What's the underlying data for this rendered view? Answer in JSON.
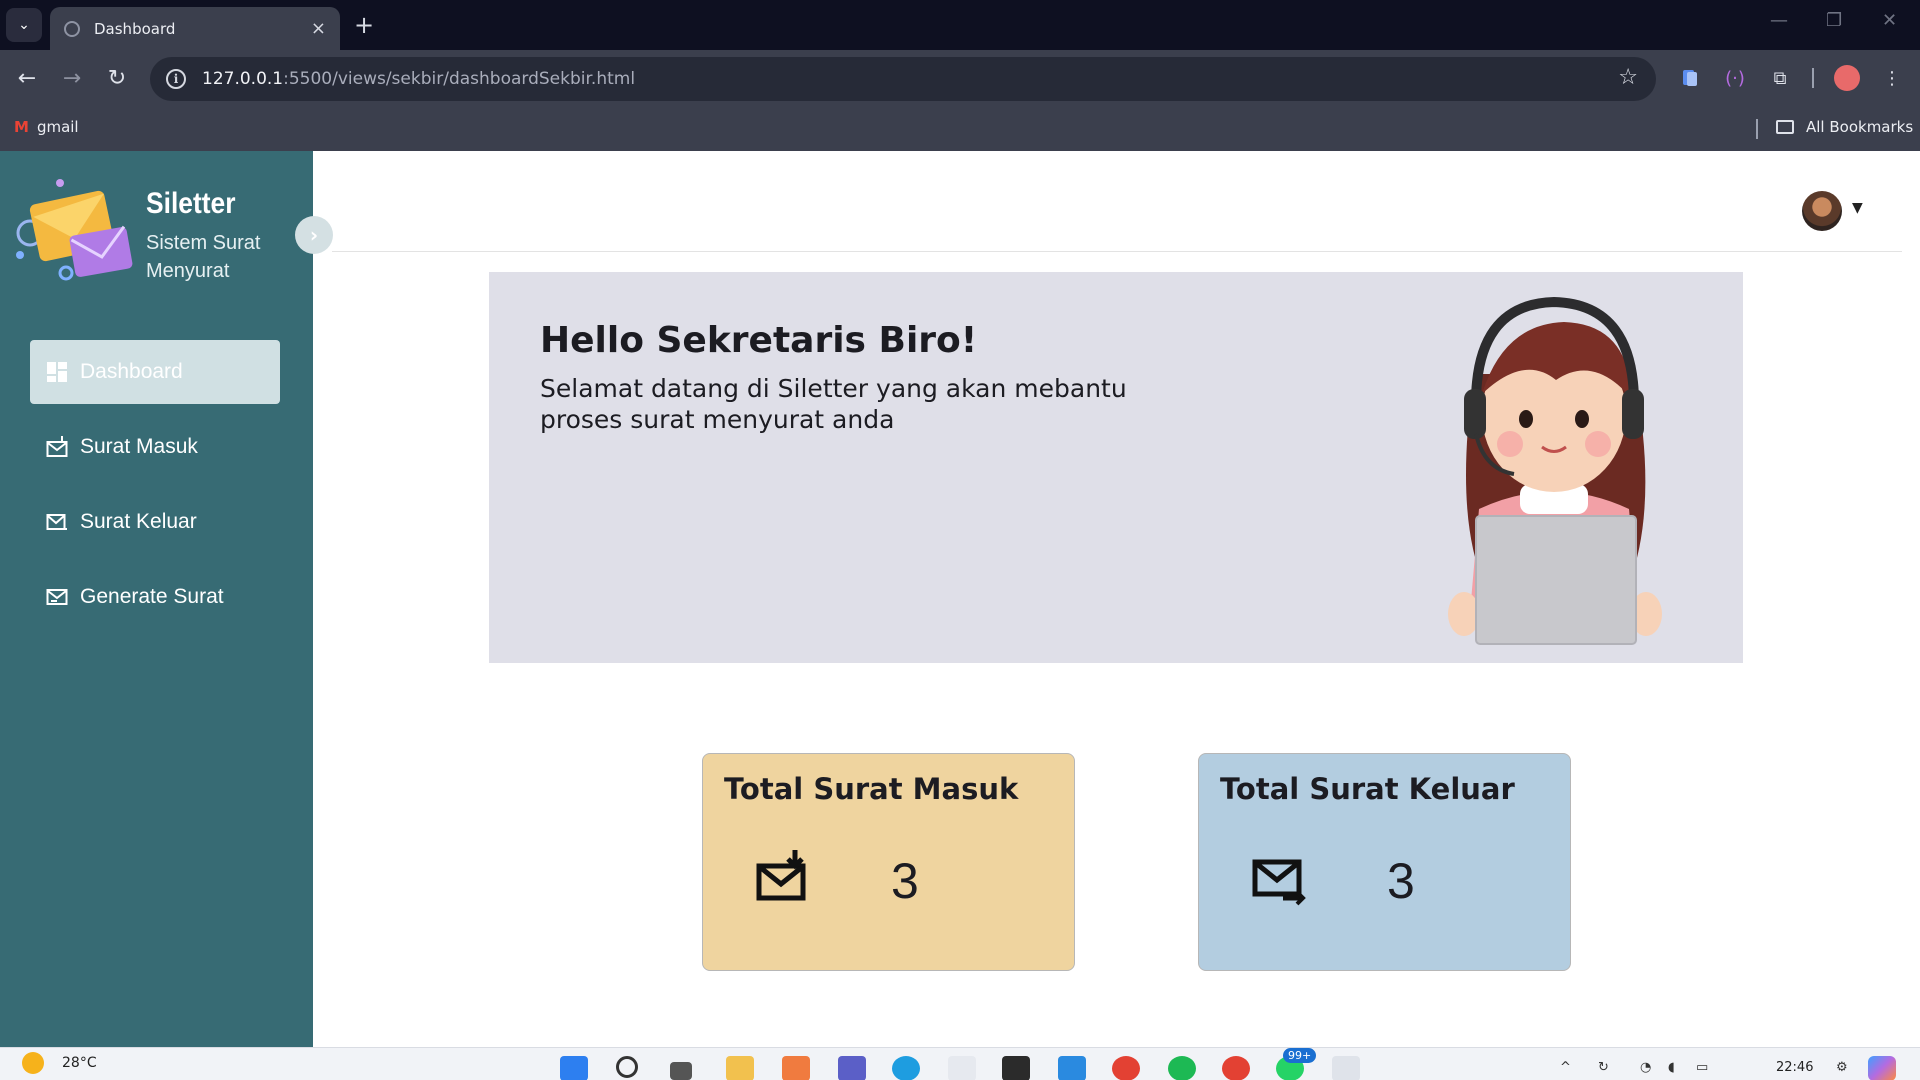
{
  "browser": {
    "tab_title": "Dashboard",
    "tab_close": "×",
    "new_tab": "+",
    "url_host": "127.0.0.1",
    "url_path": ":5500/views/sekbir/dashboardSekbir.html",
    "bookmarks": [
      {
        "label": "gmail",
        "icon": "gmail-icon"
      }
    ],
    "all_bookmarks": "All Bookmarks"
  },
  "sidebar": {
    "brand_name": "Siletter",
    "brand_sub": "Sistem Surat Menyurat",
    "items": [
      {
        "label": "Dashboard",
        "icon": "dashboard-icon",
        "active": true
      },
      {
        "label": "Surat Masuk",
        "icon": "mail-in-icon",
        "active": false
      },
      {
        "label": "Surat Keluar",
        "icon": "mail-out-icon",
        "active": false
      },
      {
        "label": "Generate Surat",
        "icon": "mail-generate-icon",
        "active": false
      }
    ]
  },
  "hero": {
    "title": "Hello Sekretaris Biro!",
    "subtitle": "Selamat datang di Siletter yang akan mebantu proses surat menyurat anda"
  },
  "cards": [
    {
      "title": "Total Surat Masuk",
      "value": "3",
      "icon": "mail-in-icon",
      "color": "#efd49f"
    },
    {
      "title": "Total Surat Keluar",
      "value": "3",
      "icon": "mail-out-icon",
      "color": "#b3cde0"
    }
  ],
  "taskbar": {
    "temperature": "28°C",
    "notification_badge": "99+",
    "time": "22:46"
  },
  "colors": {
    "sidebar_bg": "#376b74",
    "active_item": "#d0e0e3",
    "hero_bg": "#dfdfe8"
  }
}
